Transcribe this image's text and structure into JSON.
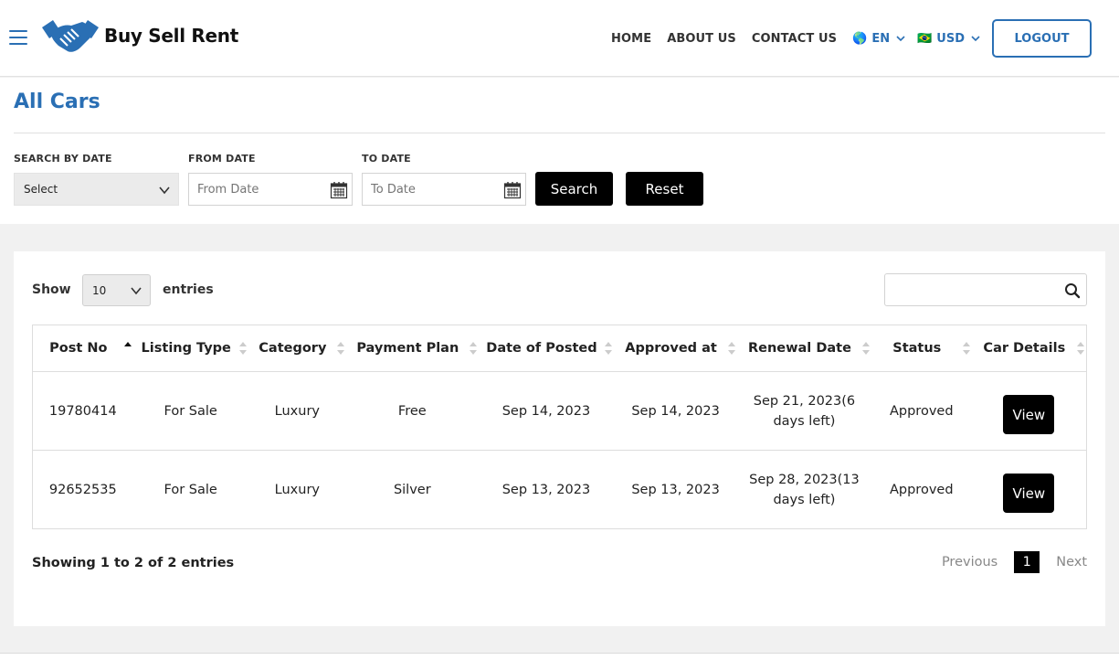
{
  "header": {
    "brand": "Buy Sell Rent",
    "nav": [
      {
        "label": "HOME"
      },
      {
        "label": "ABOUT US"
      },
      {
        "label": "CONTACT US"
      }
    ],
    "language": {
      "flag": "🌎",
      "label": "EN"
    },
    "currency": {
      "flag": "🇧🇷",
      "label": "USD"
    },
    "logout_label": "LOGOUT",
    "accent_color": "#2a6fb4"
  },
  "filters": {
    "title": "All Cars",
    "search_by_date_label": "SEARCH BY DATE",
    "search_by_date_value": "Select",
    "from_date_label": "FROM DATE",
    "from_date_placeholder": "From Date",
    "to_date_label": "TO DATE",
    "to_date_placeholder": "To Date",
    "search_label": "Search",
    "reset_label": "Reset"
  },
  "table": {
    "show_label": "Show",
    "page_length": "10",
    "entries_label": "entries",
    "columns": [
      "Post No",
      "Listing Type",
      "Category",
      "Payment Plan",
      "Date of Posted",
      "Approved at",
      "Renewal Date",
      "Status",
      "Car Details"
    ],
    "rows": [
      {
        "post_no": "19780414",
        "listing_type": "For Sale",
        "category": "Luxury",
        "payment_plan": "Free",
        "date_posted": "Sep 14, 2023",
        "approved_at": "Sep 14, 2023",
        "renewal_date": "Sep 21, 2023(6 days left)",
        "status": "Approved",
        "action": "View"
      },
      {
        "post_no": "92652535",
        "listing_type": "For Sale",
        "category": "Luxury",
        "payment_plan": "Silver",
        "date_posted": "Sep 13, 2023",
        "approved_at": "Sep 13, 2023",
        "renewal_date": "Sep 28, 2023(13 days left)",
        "status": "Approved",
        "action": "View"
      }
    ],
    "info": "Showing 1 to 2 of 2 entries",
    "pagination": {
      "previous": "Previous",
      "current": "1",
      "next": "Next"
    }
  }
}
